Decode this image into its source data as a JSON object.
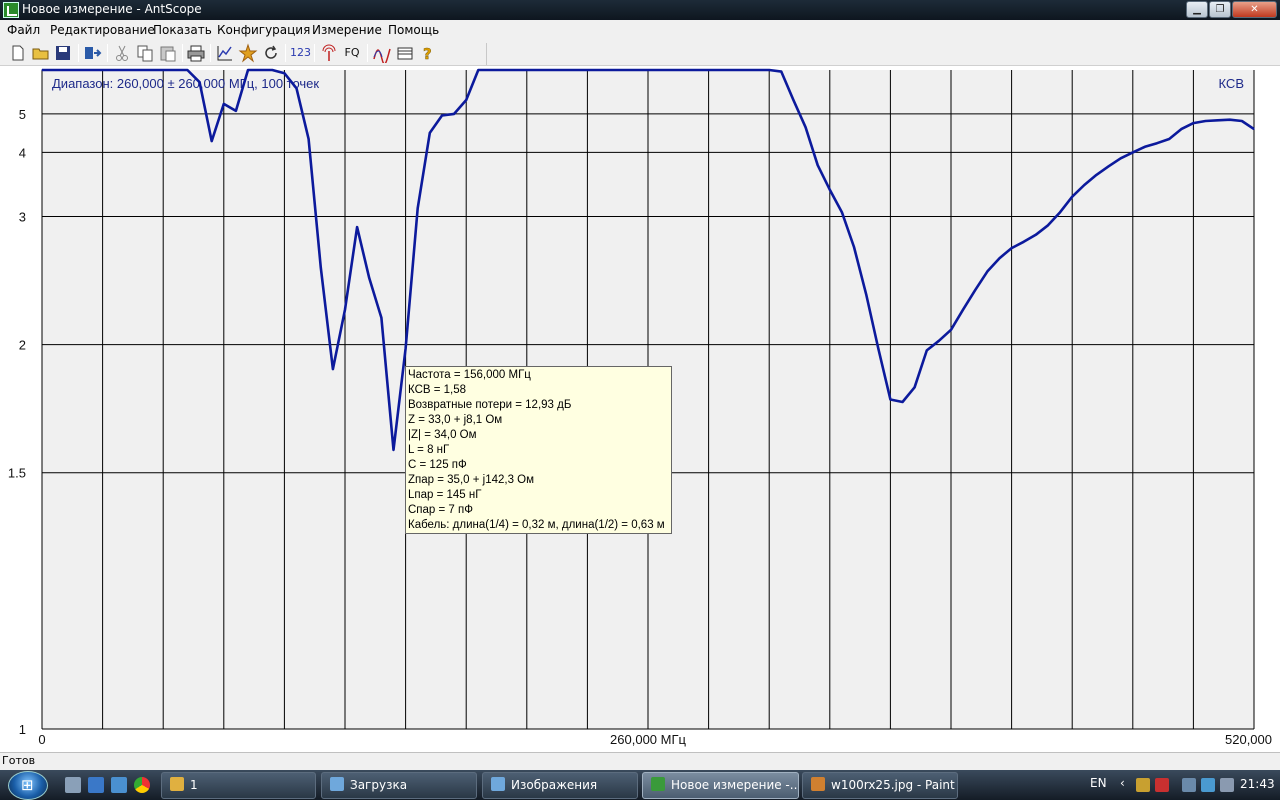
{
  "window": {
    "title": "Новое измерение - AntScope",
    "min_glyph": "▁",
    "max_glyph": "❐",
    "close_glyph": "✕"
  },
  "menu": [
    "Файл",
    "Редактирование",
    "Показать",
    "Конфигурация",
    "Измерение",
    "Помощь"
  ],
  "toolbar": {
    "icons": [
      "new-file-icon",
      "open-folder-icon",
      "save-icon",
      "export-icon",
      "cut-icon",
      "copy-icon",
      "paste-icon",
      "print-icon",
      "graph-icon",
      "marker-icon",
      "refresh-icon",
      "numeric-icon",
      "antenna-icon",
      "fq-icon",
      "curve-icon",
      "folder-icon",
      "help-icon"
    ],
    "numeric_label": "123",
    "fq_label": "FQ"
  },
  "chart": {
    "range_label": "Диапазон: 260,000 ± 260,000 МГц, 100 точек",
    "series_label": "КСВ",
    "x_tick_labels": [
      "0",
      "260,000 МГц",
      "520,000"
    ],
    "y_tick_labels": [
      "1",
      "1.5",
      "2",
      "3",
      "4",
      "5"
    ]
  },
  "chart_data": {
    "type": "line",
    "title": "Диапазон: 260,000 ± 260,000 МГц, 100 точек",
    "ylabel": "КСВ",
    "xlim": [
      0,
      520
    ],
    "x_unit": "МГц",
    "y_scale": "swr (1/SWR spacing)",
    "ylim": [
      1,
      7
    ],
    "grid": true,
    "color": "#0c1a9c",
    "series": [
      {
        "name": "КСВ",
        "x": [
          0,
          62.4,
          67.6,
          72.8,
          78.0,
          83.2,
          88.4,
          93.6,
          98.8,
          104.0,
          109.2,
          114.4,
          119.6,
          124.8,
          130.0,
          135.2,
          140.4,
          145.6,
          150.8,
          156.0,
          161.2,
          166.4,
          171.6,
          176.8,
          182.0,
          187.2,
          192.4,
          197.6,
          202.8,
          208.0,
          312.0,
          317.2,
          322.4,
          327.6,
          332.8,
          338.0,
          343.2,
          348.4,
          353.6,
          358.8,
          364.0,
          369.2,
          374.4,
          379.6,
          384.8,
          390.0,
          395.2,
          400.4,
          405.6,
          410.8,
          416.0,
          421.2,
          426.4,
          431.6,
          436.8,
          442.0,
          447.2,
          452.4,
          457.6,
          462.8,
          468.0,
          473.2,
          478.4,
          483.6,
          488.8,
          494.0,
          499.2,
          504.4,
          509.6,
          514.8,
          520.0
        ],
        "y": [
          7.0,
          7.0,
          6.3,
          4.25,
          5.35,
          5.1,
          7.0,
          7.0,
          7.0,
          6.8,
          6.0,
          4.3,
          2.5,
          1.88,
          2.2,
          2.88,
          2.42,
          2.15,
          1.57,
          1.98,
          3.1,
          4.45,
          4.95,
          5.0,
          5.5,
          7.0,
          7.0,
          7.0,
          7.0,
          7.0,
          7.0,
          6.9,
          5.5,
          4.6,
          3.75,
          3.35,
          3.05,
          2.68,
          2.3,
          1.98,
          1.75,
          1.74,
          1.8,
          1.97,
          2.02,
          2.08,
          2.2,
          2.33,
          2.47,
          2.58,
          2.67,
          2.73,
          2.8,
          2.9,
          3.05,
          3.25,
          3.42,
          3.58,
          3.73,
          3.88,
          4.0,
          4.12,
          4.2,
          4.3,
          4.55,
          4.72,
          4.78,
          4.8,
          4.82,
          4.78,
          4.55
        ]
      }
    ]
  },
  "tooltip": {
    "lines": [
      "Частота = 156,000 МГц",
      "КСВ = 1,58",
      "Возвратные потери = 12,93 дБ",
      "Z = 33,0 + j8,1 Ом",
      "|Z| = 34,0 Ом",
      "L = 8 нГ",
      "C = 125 пФ",
      "Zпар = 35,0 + j142,3 Ом",
      "Lпар = 145 нГ",
      "Cпар = 7 пФ",
      "Кабель: длина(1/4) = 0,32 м, длина(1/2) = 0,63 м"
    ]
  },
  "status": {
    "text": "Готов"
  },
  "taskbar": {
    "tasks": [
      {
        "label": "1",
        "color": "#e0b040",
        "name": "task-folder-1"
      },
      {
        "label": "Загрузка",
        "color": "#6fa8dc",
        "name": "task-downloads"
      },
      {
        "label": "Изображения",
        "color": "#6fa8dc",
        "name": "task-images"
      },
      {
        "label": "Новое измерение -...",
        "color": "#3a9a3a",
        "name": "task-antscope"
      },
      {
        "label": "w100rx25.jpg - Paint",
        "color": "#d08030",
        "name": "task-paint"
      }
    ],
    "language": "EN",
    "clock": "21:43"
  }
}
